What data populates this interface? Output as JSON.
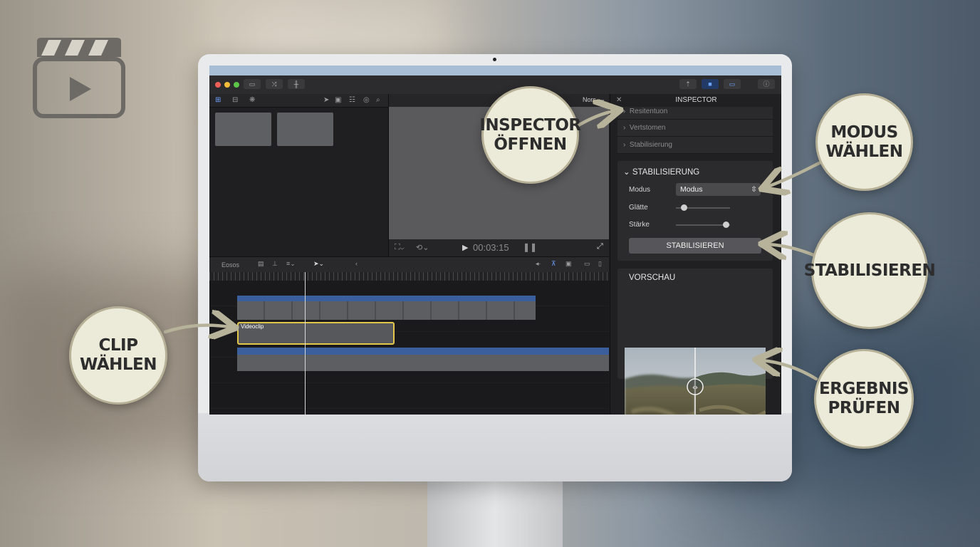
{
  "app": {
    "browser_toolbar_label": "",
    "viewer_zoom": "Nors",
    "timecode": "00:03:15",
    "timeline_index_label": "Eosos",
    "selected_clip_name": "Videoclip"
  },
  "inspector": {
    "title": "INSPECTOR",
    "collapsed_sections": [
      "Resitentuon",
      "Vertstomen",
      "Stabilisierung"
    ],
    "stabilization": {
      "header": "STABILISIERUNG",
      "mode_label": "Modus",
      "mode_value": "Modus",
      "smoothness_label": "Glätte",
      "smoothness_value": 0.15,
      "strength_label": "Stärke",
      "strength_value": 0.92,
      "button": "STABILISIEREN"
    },
    "preview": {
      "header": "VORSCHAU",
      "split_position": 0.5
    }
  },
  "callouts": {
    "inspector": "INSPECTOR ÖFFNEN",
    "mode": "MODUS WÄHLEN",
    "stabilize": "STABILISIEREN",
    "clip": "CLIP WÄHLEN",
    "result": "ERGEBNIS PRÜFEN"
  },
  "colors": {
    "selection": "#e3c64a",
    "clip_blue": "#3a5f9c",
    "bubble_fill": "#ecead9",
    "bubble_border": "#b6b097"
  },
  "icons": [
    "clapperboard-play-icon",
    "close-icon",
    "chevron-right-icon",
    "chevron-down-icon",
    "select-updown-icon",
    "play-icon",
    "fullscreen-icon",
    "arrow-tool-icon",
    "split-handle-icon"
  ]
}
